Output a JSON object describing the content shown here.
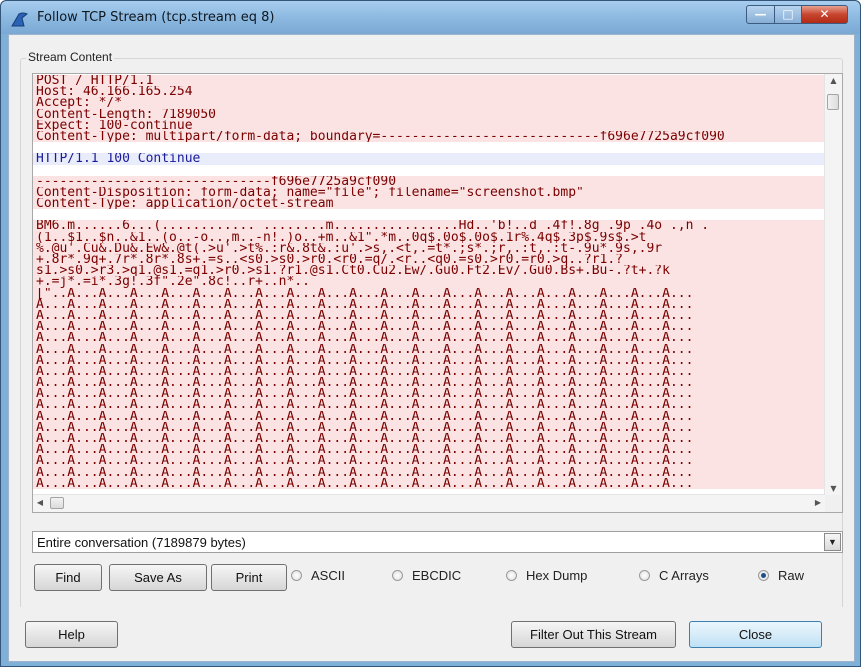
{
  "window": {
    "title": "Follow TCP Stream (tcp.stream eq 8)"
  },
  "stream_group_label": "Stream Content",
  "stream_lines": [
    {
      "text": "POST / HTTP/1.1",
      "side": "client"
    },
    {
      "text": "Host: 46.166.165.254",
      "side": "client"
    },
    {
      "text": "Accept: */*",
      "side": "client"
    },
    {
      "text": "Content-Length: 7189050",
      "side": "client"
    },
    {
      "text": "Expect: 100-continue",
      "side": "client"
    },
    {
      "text": "Content-Type: multipart/form-data; boundary=----------------------------f696e7725a9cf090",
      "side": "client"
    },
    {
      "text": "",
      "side": "blank"
    },
    {
      "text": "HTTP/1.1 100 Continue",
      "side": "server"
    },
    {
      "text": "",
      "side": "blank"
    },
    {
      "text": "------------------------------f696e7725a9cf090",
      "side": "client"
    },
    {
      "text": "Content-Disposition: form-data; name=\"file\"; filename=\"screenshot.bmp\"",
      "side": "client"
    },
    {
      "text": "Content-Type: application/octet-stream",
      "side": "client"
    },
    {
      "text": "",
      "side": "blank"
    },
    {
      "text": "BM6.m......6...(............ ........m................Hd..'b!..d .4f!.8g .9p .4o .,n .",
      "side": "client"
    },
    {
      "text": "(1..$1..$n..&1..(o..-o..,m..-n!.)o..+m..&1\".*m..0q$.0o$.0o$.1r%.4q$.3p$.9s$.>t",
      "side": "client"
    },
    {
      "text": "%.@u'.Cu&.Du&.Ew&.@t(.>u'.>t%.:r&.8t&.:u'.>s,.<t,.=t*.;s*.;r,.:t,.:t-.9u*.9s,.9r",
      "side": "client"
    },
    {
      "text": "+.8r*.9q+.7r*.8r*.8s+.=s..<s0.>s0.>r0.<r0.=q/.<r..<q0.=s0.>r0.=r0.>q..?r1.?",
      "side": "client"
    },
    {
      "text": "s1.>s0.>r3.>q1.@s1.=q1.>r0.>s1.?r1.@s1.Ct0.Cu2.Ew/.Gu0.Ft2.Ev/.Gu0.Bs+.Bu-.?t+.?k",
      "side": "client"
    },
    {
      "text": "+.=j*.=i*.3g!.3f\".2e\".8c!..r+..n*..",
      "side": "client"
    },
    {
      "text": "[\"..A...A...A...A...A...A...A...A...A...A...A...A...A...A...A...A...A...A...A...A...",
      "side": "client"
    },
    {
      "text": "A...A...A...A...A...A...A...A...A...A...A...A...A...A...A...A...A...A...A...A...A...",
      "side": "client"
    },
    {
      "text": "A...A...A...A...A...A...A...A...A...A...A...A...A...A...A...A...A...A...A...A...A...",
      "side": "client"
    },
    {
      "text": "A...A...A...A...A...A...A...A...A...A...A...A...A...A...A...A...A...A...A...A...A...",
      "side": "client"
    },
    {
      "text": "A...A...A...A...A...A...A...A...A...A...A...A...A...A...A...A...A...A...A...A...A...",
      "side": "client"
    },
    {
      "text": "A...A...A...A...A...A...A...A...A...A...A...A...A...A...A...A...A...A...A...A...A...",
      "side": "client"
    },
    {
      "text": "A...A...A...A...A...A...A...A...A...A...A...A...A...A...A...A...A...A...A...A...A...",
      "side": "client"
    },
    {
      "text": "A...A...A...A...A...A...A...A...A...A...A...A...A...A...A...A...A...A...A...A...A...",
      "side": "client"
    },
    {
      "text": "A...A...A...A...A...A...A...A...A...A...A...A...A...A...A...A...A...A...A...A...A...",
      "side": "client"
    },
    {
      "text": "A...A...A...A...A...A...A...A...A...A...A...A...A...A...A...A...A...A...A...A...A...",
      "side": "client"
    },
    {
      "text": "A...A...A...A...A...A...A...A...A...A...A...A...A...A...A...A...A...A...A...A...A...",
      "side": "client"
    },
    {
      "text": "A...A...A...A...A...A...A...A...A...A...A...A...A...A...A...A...A...A...A...A...A...",
      "side": "client"
    },
    {
      "text": "A...A...A...A...A...A...A...A...A...A...A...A...A...A...A...A...A...A...A...A...A...",
      "side": "client"
    },
    {
      "text": "A...A...A...A...A...A...A...A...A...A...A...A...A...A...A...A...A...A...A...A...A...",
      "side": "client"
    },
    {
      "text": "A...A...A...A...A...A...A...A...A...A...A...A...A...A...A...A...A...A...A...A...A...",
      "side": "client"
    },
    {
      "text": "A...A...A...A...A...A...A...A...A...A...A...A...A...A...A...A...A...A...A...A...A...",
      "side": "client"
    },
    {
      "text": "A...A...A...A...A...A...A...A...A...A...A...A...A...A...A...A...A...A...A...A...A...",
      "side": "client"
    },
    {
      "text": "A...A...A...A...A...A...A...A...A...A...A...A...A...A...A...A...A...A...A...A...A...",
      "side": "client"
    }
  ],
  "conversation_select": {
    "value": "Entire conversation (7189879 bytes)"
  },
  "actions": {
    "find": "Find",
    "save_as": "Save As",
    "print": "Print"
  },
  "formats": [
    {
      "label": "ASCII",
      "selected": false
    },
    {
      "label": "EBCDIC",
      "selected": false
    },
    {
      "label": "Hex Dump",
      "selected": false
    },
    {
      "label": "C Arrays",
      "selected": false
    },
    {
      "label": "Raw",
      "selected": true
    }
  ],
  "footer": {
    "help": "Help",
    "filter_out": "Filter Out This Stream",
    "close": "Close"
  },
  "colors": {
    "client_text": "#7a0000",
    "client_bg": "#fbe3e3",
    "server_text": "#1a1a9a",
    "server_bg": "#e8ecfb"
  }
}
